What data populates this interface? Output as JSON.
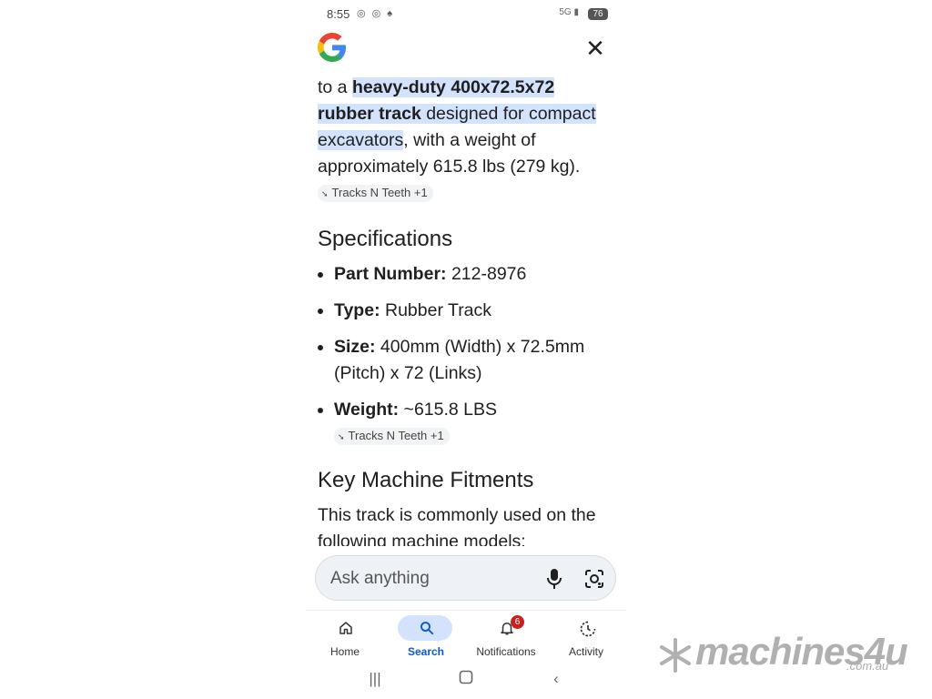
{
  "status_bar": {
    "time": "8:55",
    "app_icons": "◎ ◎ ♠",
    "signal": "5G ▮",
    "battery": "76"
  },
  "content": {
    "intro_prefix": "to a ",
    "intro_bold_1": "heavy-duty 400x72.5x72 rubber track",
    "intro_mid": " designed for compact excavators",
    "intro_rest": ", with a weight of approximately 615.8 lbs (279 kg). ",
    "source_chip_1": "Tracks N Teeth +1",
    "specs_heading": "Specifications",
    "specs": [
      {
        "label": "Part Number:",
        "value": " 212-8976"
      },
      {
        "label": "Type:",
        "value": " Rubber Track"
      },
      {
        "label": "Size:",
        "value": " 400mm (Width) x 72.5mm (Pitch) x 72 (Links)"
      },
      {
        "label": "Weight:",
        "value": " ~615.8 LBS "
      }
    ],
    "source_chip_2": "Tracks N Teeth +1",
    "fitments_heading": "Key Machine Fitments",
    "fitments_text": "This track is commonly used on the following machine models:"
  },
  "ask_bar": {
    "placeholder": "Ask anything"
  },
  "bottom_nav": {
    "items": [
      {
        "label": "Home",
        "icon": "home-icon",
        "active": false
      },
      {
        "label": "Search",
        "icon": "search-icon",
        "active": true
      },
      {
        "label": "Notifications",
        "icon": "bell-icon",
        "active": false,
        "badge": "6"
      },
      {
        "label": "Activity",
        "icon": "activity-icon",
        "active": false
      }
    ]
  },
  "watermark": {
    "brand": "machines4u",
    "domain": ".com.au"
  },
  "colors": {
    "highlight": "#d3e3fd",
    "active_blue": "#0b57d0",
    "badge_red": "#c5221f"
  }
}
